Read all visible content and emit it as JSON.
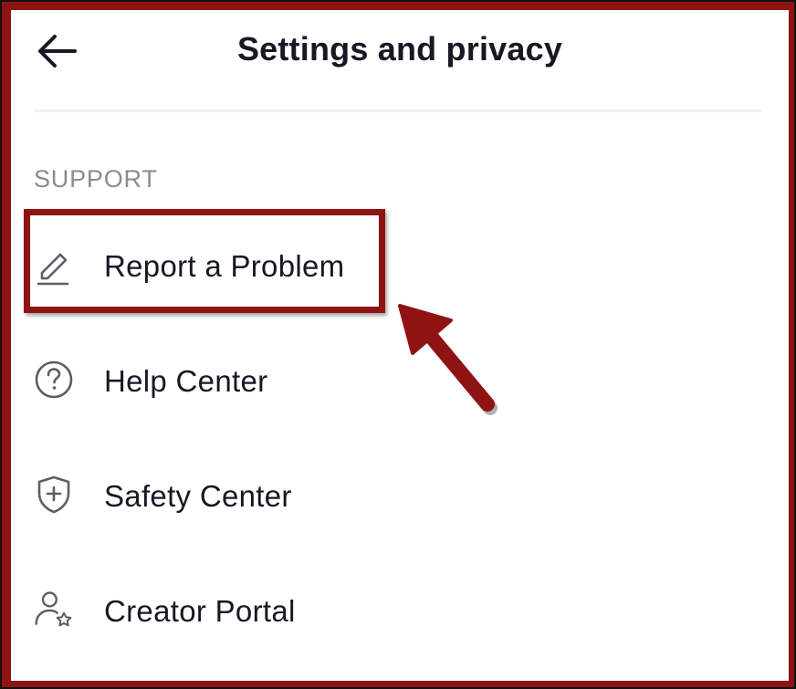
{
  "header": {
    "title": "Settings and privacy",
    "back_icon": "arrow-left-icon"
  },
  "section": {
    "label": "SUPPORT"
  },
  "items": [
    {
      "label": "Report a Problem",
      "icon": "pencil-icon"
    },
    {
      "label": "Help Center",
      "icon": "question-circle-icon"
    },
    {
      "label": "Safety Center",
      "icon": "shield-plus-icon"
    },
    {
      "label": "Creator Portal",
      "icon": "person-star-icon"
    }
  ],
  "annotation": {
    "highlight_color": "#8f1313",
    "arrow_color": "#8f1313"
  },
  "colors": {
    "text_primary": "#161823",
    "text_secondary": "#8a8b91",
    "icon": "#5c5d66"
  }
}
